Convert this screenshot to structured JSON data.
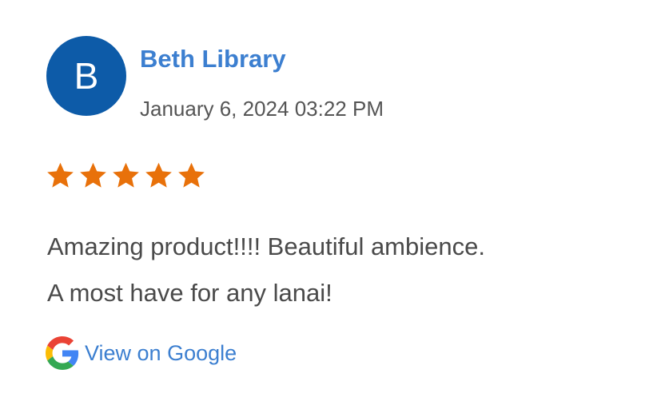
{
  "review": {
    "avatar_initial": "B",
    "author": "Beth Library",
    "date": "January 6, 2024 03:22 PM",
    "rating": 5,
    "rating_max": 5,
    "text_lines": [
      "Amazing product!!!! Beautiful ambience.",
      "A most have for any lanai!"
    ],
    "link_label": "View on Google",
    "link_icon": "google-g-icon",
    "star_icon": "star-icon"
  },
  "colors": {
    "avatar_bg": "#0d5ba8",
    "author": "#3c7fd0",
    "star": "#e8710a",
    "text": "#4a4a4a",
    "date": "#555555",
    "link": "#3c7fd0"
  }
}
